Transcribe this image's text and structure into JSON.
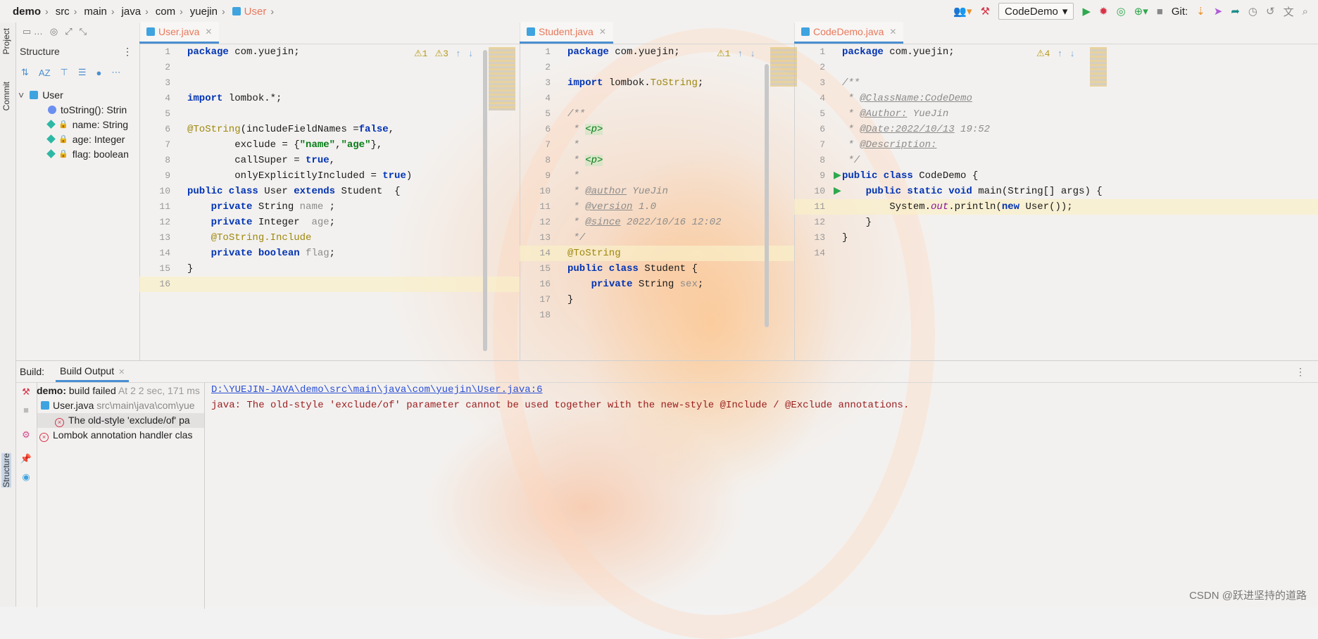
{
  "breadcrumb": [
    "demo",
    "src",
    "main",
    "java",
    "com",
    "yuejin",
    "User"
  ],
  "toolbar": {
    "run_config": "CodeDemo",
    "git_label": "Git:"
  },
  "left_strip": {
    "project": "Project",
    "commit": "Commit",
    "structure": "Structure"
  },
  "structure": {
    "title": "Structure",
    "tree": [
      {
        "label": "User",
        "kind": "class"
      },
      {
        "label": "toString(): Strin",
        "kind": "method"
      },
      {
        "label": "name: String",
        "kind": "field"
      },
      {
        "label": "age: Integer",
        "kind": "field"
      },
      {
        "label": "flag: boolean",
        "kind": "field"
      }
    ]
  },
  "editors": {
    "user": {
      "tab": "User.java",
      "warnings": {
        "a": "1",
        "b": "3"
      },
      "lines": [
        "1",
        "2",
        "3",
        "4",
        "5",
        "6",
        "7",
        "8",
        "9",
        "10",
        "11",
        "12",
        "13",
        "14",
        "15",
        "16"
      ]
    },
    "student": {
      "tab": "Student.java",
      "warnings": {
        "a": "1"
      },
      "lines": [
        "1",
        "2",
        "3",
        "4",
        "5",
        "6",
        "7",
        "8",
        "9",
        "10",
        "11",
        "12",
        "13",
        "14",
        "15",
        "16",
        "17",
        "18"
      ]
    },
    "codedemo": {
      "tab": "CodeDemo.java",
      "warnings": {
        "a": "4"
      },
      "lines": [
        "1",
        "2",
        "3",
        "4",
        "5",
        "6",
        "7",
        "8",
        "9",
        "10",
        "11",
        "12",
        "13",
        "14"
      ]
    }
  },
  "build": {
    "label": "Build:",
    "tab": "Build Output",
    "tree": {
      "root_name": "demo:",
      "root_status": " build failed",
      "root_time": " At 2 2 sec, 171 ms",
      "file": "User.java",
      "file_path": " src\\main\\java\\com\\yue",
      "error1": "The old-style 'exclude/of' pa",
      "error2": "Lombok annotation handler clas"
    },
    "output": {
      "link": "D:\\YUEJIN-JAVA\\demo\\src\\main\\java\\com\\yuejin\\User.java:6",
      "message": "java: The old-style 'exclude/of' parameter cannot be used together with the new-style @Include / @Exclude annotations."
    }
  },
  "watermark": "CSDN @跃进坚持的道路"
}
